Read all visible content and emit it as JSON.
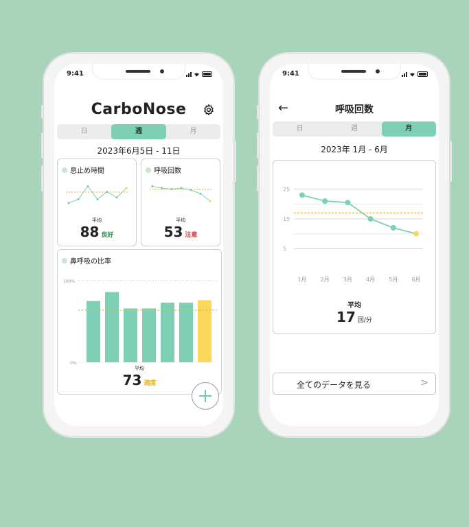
{
  "colors": {
    "accent": "#7dcfb6",
    "bar_highlight": "#fad75a",
    "avg_line": "#e8b520",
    "good": "#2f8a4f",
    "warning": "#e23e3e",
    "moderate": "#e8b520",
    "background": "#a8d5b9"
  },
  "left": {
    "status_time": "9:41",
    "app_title": "CarboNose",
    "settings_icon": "gear-icon",
    "tabs": [
      "日",
      "週",
      "月"
    ],
    "active_tab": 1,
    "date_range": "2023年6月5日 - 11日",
    "breath_hold": {
      "label": "息止め時間",
      "avg_caption": "平均",
      "avg_value": "88",
      "rating": "良好",
      "points": [
        3,
        5,
        12,
        5,
        9,
        6,
        11
      ]
    },
    "breath_count": {
      "label": "呼吸回数",
      "avg_caption": "平均",
      "avg_value": "53",
      "rating": "注意",
      "points": [
        12,
        11,
        10.5,
        11,
        10,
        8,
        4
      ]
    },
    "nasal_ratio": {
      "label": "鼻呼吸の比率",
      "tick_top": "100%",
      "tick_bottom": "0%",
      "avg_caption": "平均",
      "avg_value": "73",
      "rating": "適度",
      "bars": [
        75,
        86,
        66,
        66,
        73,
        73,
        76
      ],
      "highlight_index": 6,
      "avg_line": 64
    },
    "fab_icon": "plus-icon"
  },
  "right": {
    "status_time": "9:41",
    "back_icon": "back-arrow-icon",
    "page_title": "呼吸回数",
    "tabs": [
      "日",
      "週",
      "月"
    ],
    "active_tab": 2,
    "date_range": "2023年 1月 - 6月",
    "chart_data": {
      "type": "line",
      "x": [
        "1月",
        "2月",
        "3月",
        "4月",
        "5月",
        "6月"
      ],
      "series": [
        {
          "values": [
            23,
            21,
            20.5,
            15,
            12,
            10
          ]
        }
      ],
      "y_ticks": [
        "25",
        "15",
        "5"
      ],
      "ylim": [
        0,
        30
      ],
      "average_line": 17,
      "grid": true
    },
    "avg_caption": "平均",
    "avg_value": "17",
    "avg_unit": "回/分",
    "all_data_button": "全てのデータを見る"
  }
}
